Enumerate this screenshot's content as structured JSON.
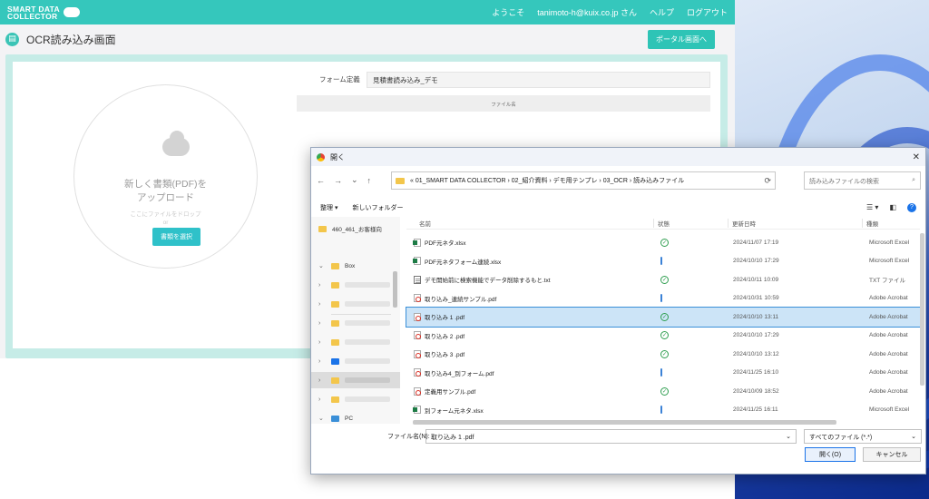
{
  "app": {
    "logo_line1": "SMART DATA",
    "logo_line2": "COLLECTOR",
    "welcome": "ようこそ",
    "user": "tanimoto-h@kuix.co.jp さん",
    "help": "ヘルプ",
    "logout": "ログアウト",
    "page_title": "OCR読み込み画面",
    "portal_button": "ポータル画面へ",
    "upload_main_line1": "新しく書類(PDF)を",
    "upload_main_line2": "アップロード",
    "upload_sub": "ここにファイルをドロップ",
    "upload_or": "or",
    "select_button": "書類を選択",
    "form_label": "フォーム定義",
    "form_value": "見積書読み込み_デモ",
    "file_column": "ファイル名",
    "accent": "#35c7bc"
  },
  "dialog": {
    "title": "開く",
    "close_icon": "✕",
    "breadcrumb": "«  01_SMART DATA COLLECTOR  ›  02_紹介資料  ›  デモ用テンプレ  ›  03_OCR  ›  読み込みファイル",
    "search_placeholder": "読み込みファイルの検索",
    "organize": "整理 ▾",
    "new_folder": "新しいフォルダー",
    "nav": {
      "top_folder": "460_461_お客様向",
      "box": "Box",
      "pc": "PC"
    },
    "columns": {
      "name": "名前",
      "state": "状態",
      "date": "更新日時",
      "type": "種類"
    },
    "files": [
      {
        "name": "PDF元ネタ.xlsx",
        "icon": "xlsx",
        "state": "ok",
        "date": "2024/11/07 17:19",
        "type": "Microsoft Excel"
      },
      {
        "name": "PDF元ネタフォーム連続.xlsx",
        "icon": "xlsx",
        "state": "cloud",
        "date": "2024/10/10 17:29",
        "type": "Microsoft Excel"
      },
      {
        "name": "デモ開始前に検索機能でデータ削除するもと.txt",
        "icon": "txt",
        "state": "ok",
        "date": "2024/10/11 10:09",
        "type": "TXT ファイル"
      },
      {
        "name": "取り込み_連続サンプル.pdf",
        "icon": "pdf",
        "state": "cloud",
        "date": "2024/10/31 10:59",
        "type": "Adobe Acrobat"
      },
      {
        "name": "取り込み 1 .pdf",
        "icon": "pdf",
        "state": "ok",
        "date": "2024/10/10 13:11",
        "type": "Adobe Acrobat",
        "selected": true
      },
      {
        "name": "取り込み 2 .pdf",
        "icon": "pdf",
        "state": "ok",
        "date": "2024/10/10 17:29",
        "type": "Adobe Acrobat"
      },
      {
        "name": "取り込み 3 .pdf",
        "icon": "pdf",
        "state": "ok",
        "date": "2024/10/10 13:12",
        "type": "Adobe Acrobat"
      },
      {
        "name": "取り込み4_別フォーム.pdf",
        "icon": "pdf",
        "state": "cloud",
        "date": "2024/11/25 16:10",
        "type": "Adobe Acrobat"
      },
      {
        "name": "定義用サンプル.pdf",
        "icon": "pdf",
        "state": "ok",
        "date": "2024/10/09 18:52",
        "type": "Adobe Acrobat"
      },
      {
        "name": "別フォーム元ネタ.xlsx",
        "icon": "xlsx",
        "state": "cloud",
        "date": "2024/11/25 16:11",
        "type": "Microsoft Excel"
      }
    ],
    "filename_label": "ファイル名(N):",
    "filename_value": "取り込み 1 .pdf",
    "filetype_value": "すべてのファイル (*.*)",
    "open_button": "開く(O)",
    "cancel_button": "キャンセル"
  }
}
